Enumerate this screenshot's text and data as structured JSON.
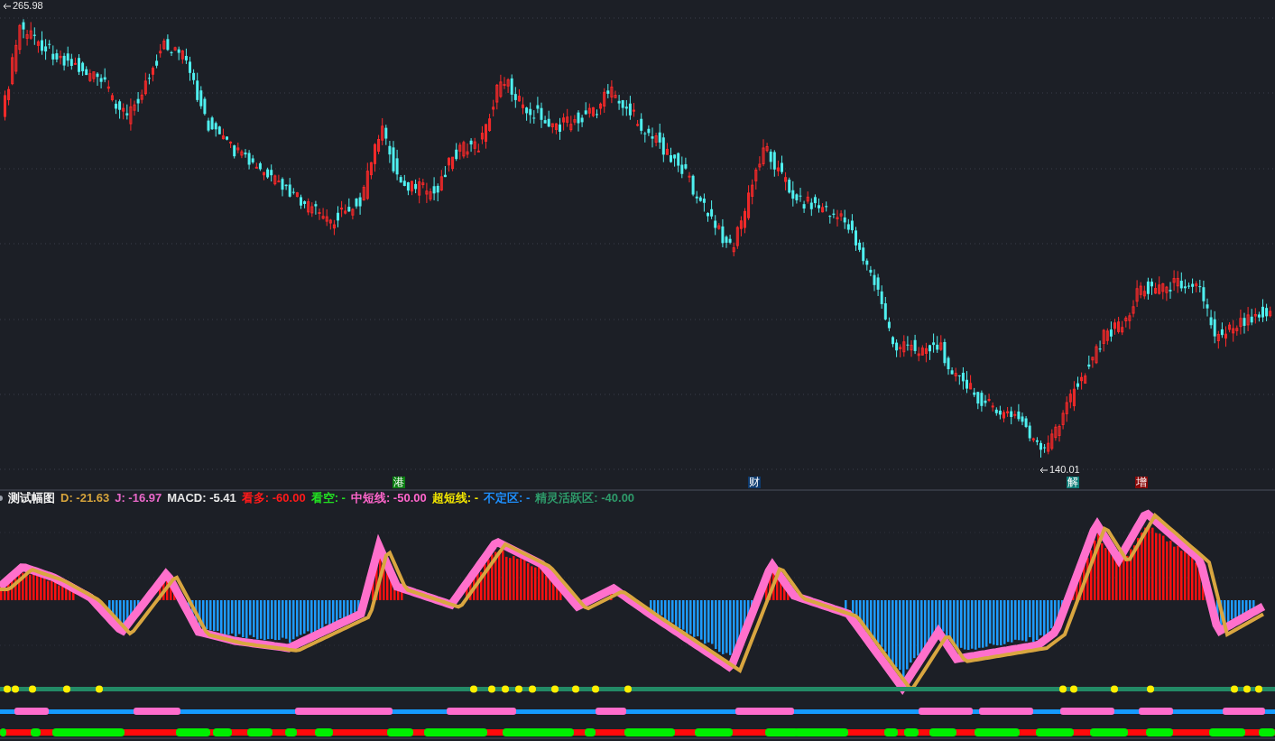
{
  "price_chart": {
    "high_label": "265.98",
    "low_label": "140.01",
    "events": [
      {
        "label": "港",
        "color": "#0b7d12"
      },
      {
        "label": "财",
        "color": "#0d3a6e"
      },
      {
        "label": "解",
        "color": "#0d7d78"
      },
      {
        "label": "增",
        "color": "#8a0a0a"
      }
    ]
  },
  "indicator": {
    "title": "测试幅图",
    "legend": [
      {
        "text": "D: -21.63",
        "color": "#d6a43c"
      },
      {
        "text": "J: -16.97",
        "color": "#e868c8"
      },
      {
        "text": "MACD: -5.41",
        "color": "#e8e8e8"
      },
      {
        "text": "看多: -60.00",
        "color": "#ff1a1a"
      },
      {
        "text": "看空: -",
        "color": "#22dd22"
      },
      {
        "text": "中短线: -50.00",
        "color": "#ff66cc"
      },
      {
        "text": "超短线: -",
        "color": "#f2e600"
      },
      {
        "text": "不定区: -",
        "color": "#1e90ff"
      },
      {
        "text": "精灵活跃区: -40.00",
        "color": "#2e9a6a"
      }
    ]
  }
}
